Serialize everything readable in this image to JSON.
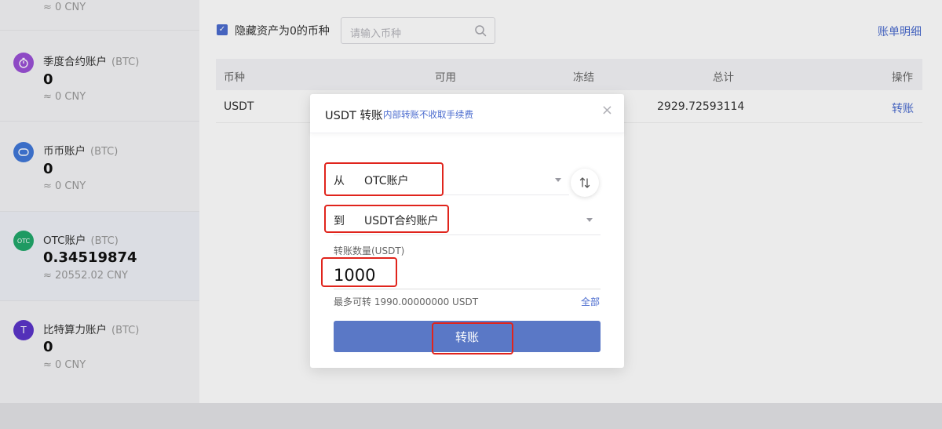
{
  "sidebar": {
    "accounts": [
      {
        "name": "",
        "unit": "",
        "value": "",
        "cny": "≈ 0 CNY"
      },
      {
        "name": "季度合约账户",
        "unit": "(BTC)",
        "value": "0",
        "cny": "≈ 0 CNY",
        "icon": "stopwatch-icon",
        "color": "#9b51d6"
      },
      {
        "name": "币币账户",
        "unit": "(BTC)",
        "value": "0",
        "cny": "≈ 0 CNY",
        "icon": "exchange-icon",
        "color": "#4178d8"
      },
      {
        "name": "OTC账户",
        "unit": "(BTC)",
        "value": "0.34519874",
        "cny": "≈ 20552.02 CNY",
        "icon": "otc-icon",
        "icon_text": "OTC",
        "color": "#21a86b"
      },
      {
        "name": "比特算力账户",
        "unit": "(BTC)",
        "value": "0",
        "cny": "≈ 0 CNY",
        "icon": "tether-icon",
        "icon_text": "T",
        "color": "#5b35c9"
      }
    ]
  },
  "toolbar": {
    "hide_zero_label": "隐藏资产为0的币种",
    "hide_zero_checked": true,
    "search_placeholder": "请输入币种",
    "bill_link": "账单明细"
  },
  "table": {
    "headers": [
      "币种",
      "可用",
      "冻结",
      "总计",
      "操作"
    ],
    "rows": [
      {
        "coin": "USDT",
        "total": "2929.72593114",
        "action": "转账"
      }
    ]
  },
  "modal": {
    "title": "USDT 转账",
    "subtitle": "内部转账不收取手续费",
    "from_prefix": "从",
    "from_value": "OTC账户",
    "to_prefix": "到",
    "to_value": "USDT合约账户",
    "amount_label": "转账数量(USDT)",
    "amount_value": "1000",
    "max_text": "最多可转 1990.00000000 USDT",
    "all_label": "全部",
    "submit_label": "转账",
    "close_glyph": "×"
  },
  "colors": {
    "accent": "#4b6ccf",
    "button": "#5a78c6",
    "annotation": "#e0241c"
  }
}
